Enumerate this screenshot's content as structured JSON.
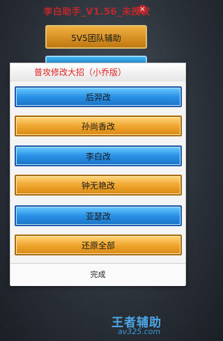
{
  "background": {
    "title": "李白助手_V1.56_未授权",
    "close_icon": "×",
    "team_button": "5V5团队辅助"
  },
  "dialog": {
    "title": "普攻修改大招（小乔版）",
    "options": [
      "后羿改",
      "孙尚香改",
      "李白改",
      "钟无艳改",
      "亚瑟改",
      "还原全部"
    ],
    "done_label": "完成"
  },
  "watermark": {
    "line1": "王者辅助",
    "line2": "av325.com"
  },
  "colors": {
    "accent_red": "#e0201e",
    "blue_button": "#2a92e6",
    "gold_button": "#f0a630"
  }
}
